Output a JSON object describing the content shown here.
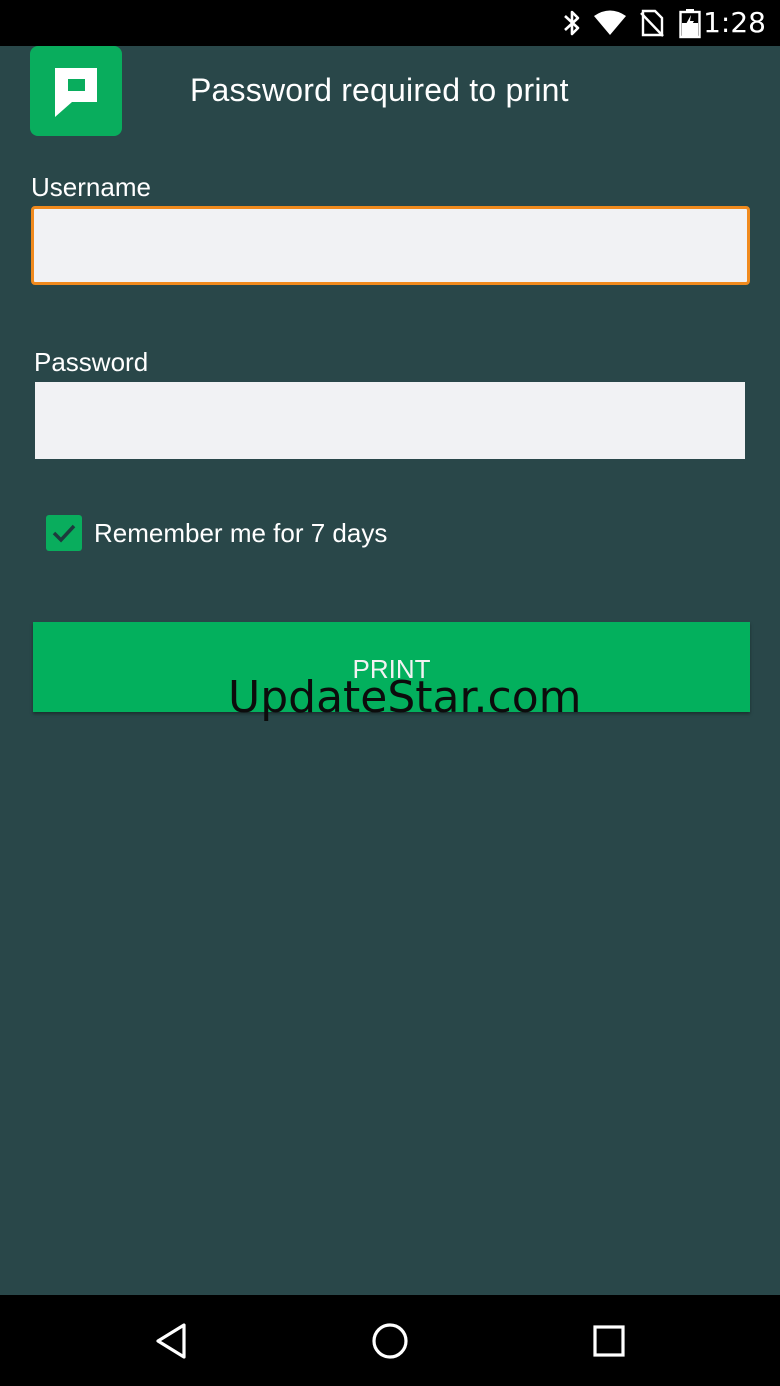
{
  "status_bar": {
    "time": "1:28",
    "icons": [
      "bluetooth-icon",
      "wifi-icon",
      "no-sim-icon",
      "battery-icon"
    ]
  },
  "app": {
    "logo": "papercut-logo",
    "title": "Password required to print"
  },
  "form": {
    "username_label": "Username",
    "username_value": "",
    "password_label": "Password",
    "password_value": "",
    "remember_label": "Remember me for 7 days",
    "remember_checked": true,
    "print_label": "PRINT"
  },
  "watermark": "UpdateStar.com",
  "nav_bar": {
    "buttons": [
      "back-icon",
      "home-icon",
      "recents-icon"
    ]
  },
  "colors": {
    "background": "#294749",
    "accent_green": "#09ad5d",
    "focus_orange": "#f08a1d",
    "input_background": "#f1f2f4"
  }
}
